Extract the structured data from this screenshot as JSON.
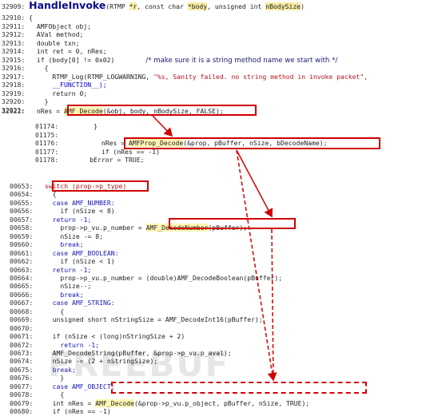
{
  "watermark": "FREEBUF",
  "block1": {
    "title_num": "32909:",
    "func_name": "HandleInvoke",
    "sig_parts": [
      "(RTMP ",
      "*r",
      ", const char ",
      "*body",
      ", unsigned int ",
      "nBodySize",
      ")"
    ],
    "lines": [
      [
        "32910:",
        "{"
      ],
      [
        "32911:",
        "  AMFObject obj;"
      ],
      [
        "32912:",
        "  AVal method;"
      ],
      [
        "32913:",
        "  double txn;"
      ],
      [
        "32914:",
        "  int ret = 0, nRes;"
      ],
      [
        "32915:",
        "  if (body[0] != 0x02)"
      ],
      [
        "32916:",
        "    {"
      ],
      [
        "32917:",
        "      RTMP_Log(RTMP_LOGWARNING, "
      ],
      [
        "32918:",
        "      __FUNCTION__);"
      ],
      [
        "32919:",
        "      return 0;"
      ],
      [
        "32920:",
        "    }"
      ],
      [
        "32921:",
        ""
      ],
      [
        "32922:",
        "  nRes = "
      ]
    ],
    "comment": "/* make sure it is a string method name we start with */",
    "log_string": "\"%s, Sanity failed. no string method in invoke packet\",",
    "decode_call": "AMF_Decode",
    "decode_args": "(&obj, body, nBodySize, FALSE);"
  },
  "block2": {
    "lines": [
      [
        "01174:",
        "        }"
      ],
      [
        "01175:",
        ""
      ],
      [
        "01176:",
        "          nRes = "
      ],
      [
        "01177:",
        "          if (nRes == -1)"
      ],
      [
        "01178:",
        "       bError = TRUE;"
      ]
    ],
    "call": "AMFProp_Decode",
    "call_args": "(&prop, pBuffer, nSize, bDecodeName);"
  },
  "block3": {
    "lines": [
      [
        "00653:",
        "  switch (prop->p_type)"
      ],
      [
        "00654:",
        "    {"
      ],
      [
        "00655:",
        "    case AMF_NUMBER:"
      ],
      [
        "00656:",
        "      if (nSize < 8)"
      ],
      [
        "00657:",
        "    return -1;"
      ],
      [
        "00658:",
        "      prop->p_vu.p_number = "
      ],
      [
        "00659:",
        "      nSize -= 8;"
      ],
      [
        "00660:",
        "      break;"
      ],
      [
        "00661:",
        "    case AMF_BOOLEAN:"
      ],
      [
        "00662:",
        "      if (nSize < 1)"
      ],
      [
        "00663:",
        "    return -1;"
      ],
      [
        "00664:",
        "      prop->p_vu.p_number = (double)AMF_DecodeBoolean(pBuffer);"
      ],
      [
        "00665:",
        "      nSize--;"
      ],
      [
        "00666:",
        "      break;"
      ],
      [
        "00667:",
        "    case AMF_STRING:"
      ],
      [
        "00668:",
        "      {"
      ],
      [
        "00669:",
        "    unsigned short nStringSize = AMF_DecodeInt16(pBuffer);"
      ],
      [
        "00670:",
        ""
      ],
      [
        "00671:",
        "    if (nSize < (long)nStringSize + 2)"
      ],
      [
        "00672:",
        "      return -1;"
      ],
      [
        "00673:",
        "    AMF_DecodeString(pBuffer, &prop->p_vu.p_aval);"
      ],
      [
        "00674:",
        "    nSize -= (2 + nStringSize);"
      ],
      [
        "00675:",
        "    break;"
      ],
      [
        "00676:",
        "      }"
      ],
      [
        "00677:",
        "    case AMF_OBJECT:"
      ],
      [
        "00678:",
        "      {"
      ],
      [
        "00679:",
        "    int nRes = "
      ],
      [
        "00680:",
        "    if (nRes == -1)"
      ]
    ],
    "number_call": "AMF_DecodeNumber",
    "number_args": "(pBuffer);",
    "object_call": "AMF_Decode",
    "object_args": "(&prop->p_vu.p_object, pBuffer, nSize, TRUE);"
  },
  "colors": {
    "box": "#d10000",
    "keyword": "#1a1ab0",
    "string": "#b5121b",
    "title": "#0a0a8c"
  }
}
